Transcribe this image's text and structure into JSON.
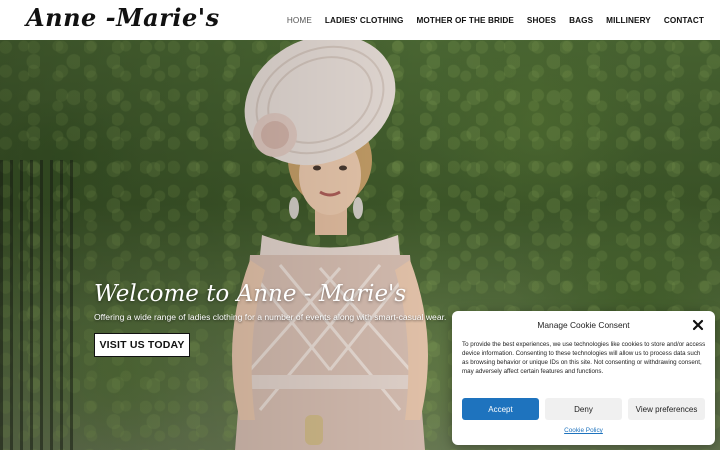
{
  "header": {
    "logo": "Anne -Marie's",
    "nav": [
      {
        "label": "HOME",
        "active": true
      },
      {
        "label": "LADIES' CLOTHING",
        "active": false
      },
      {
        "label": "MOTHER OF THE BRIDE",
        "active": false
      },
      {
        "label": "SHOES",
        "active": false
      },
      {
        "label": "BAGS",
        "active": false
      },
      {
        "label": "MILLINERY",
        "active": false
      },
      {
        "label": "CONTACT",
        "active": false
      }
    ]
  },
  "hero": {
    "title": "Welcome to Anne - Marie's",
    "subtitle": "Offering a wide range of ladies clothing for a number of events along with smart-casual wear.",
    "button": "VISIT US TODAY"
  },
  "cookie": {
    "title": "Manage Cookie Consent",
    "text": "To provide the best experiences, we use technologies like cookies to store and/or access device information. Consenting to these technologies will allow us to process data such as browsing behavior or unique IDs on this site. Not consenting or withdrawing consent, may adversely affect certain features and functions.",
    "accept": "Accept",
    "deny": "Deny",
    "preferences": "View preferences",
    "policy": "Cookie Policy",
    "accent_color": "#1e73be"
  }
}
